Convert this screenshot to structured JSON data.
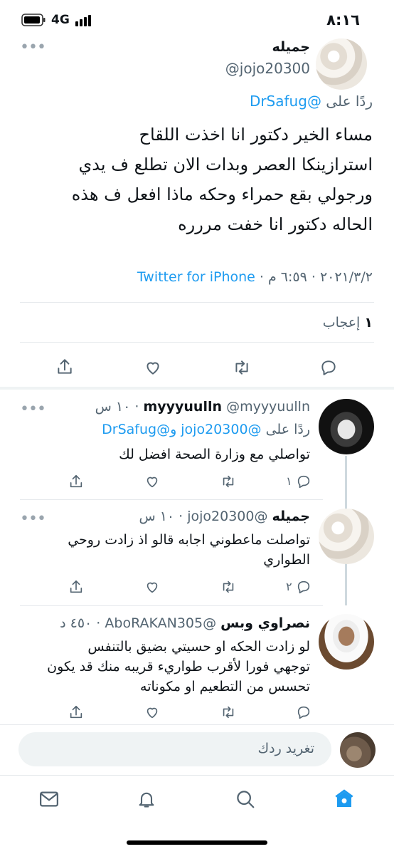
{
  "status_bar": {
    "time": "٨:١٦",
    "network": "4G"
  },
  "main_tweet": {
    "name": "جميله",
    "handle": "@jojo20300",
    "reply_prefix": "ردًا على",
    "reply_to": "@DrSafug",
    "text_lines": [
      "مساء الخير دكتور انا اخذت اللقاح",
      "استرازينكا العصر وبدات الان تطلع ف يدي",
      "ورجولي بقع حمراء وحكه ماذا افعل ف هذه",
      "الحاله دكتور انا خفت مررره"
    ],
    "date_time": "٢٠٢١/٣/٢ · ٦:٥٩ م ·",
    "source": "Twitter for iPhone",
    "likes_count": "١",
    "likes_label": "إعجاب"
  },
  "replies": [
    {
      "name": "myyyuulln",
      "handle_time": "@myyyuulln · ١٠ س",
      "reply_prefix": "ردًا على",
      "reply_to": "@jojo20300 و@DrSafug",
      "text_lines": [
        "تواصلي  مع وزارة الصحة افضل لك"
      ],
      "reply_count": "١"
    },
    {
      "name": "جميله",
      "handle_time": "@jojo20300 · ١٠ س",
      "text_lines": [
        "تواصلت ماعطوني اجابه قالو اذ زادت روحي",
        "الطواري"
      ],
      "reply_count": "٢"
    },
    {
      "name": "نصراوي وبس",
      "handle_time": "@AboRAKAN305 · ٤٥٠ د",
      "text_lines": [
        "لو زادت الحكه او حسيتي بضيق بالتنفس",
        "توجهي فورا لأقرب طواريء قريبه منك قد يكون",
        "تحسس من التطعيم او مكوناته"
      ],
      "reply_count": ""
    }
  ],
  "composer": {
    "placeholder": "تغريد ردك"
  },
  "tab_bar": {
    "items": [
      "home-icon",
      "search-icon",
      "notifications-icon",
      "messages-icon"
    ]
  },
  "colors": {
    "accent": "#1d9bf0",
    "text": "#0f1419",
    "muted": "#536471",
    "divider": "#e6e9ec"
  }
}
